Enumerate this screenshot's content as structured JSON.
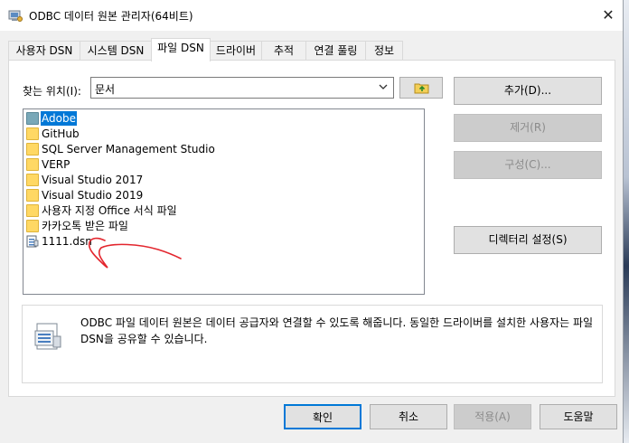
{
  "window": {
    "title": "ODBC 데이터 원본 관리자(64비트)",
    "close_glyph": "✕"
  },
  "tabs": [
    {
      "label": "사용자 DSN"
    },
    {
      "label": "시스템 DSN"
    },
    {
      "label": "파일 DSN",
      "active": true
    },
    {
      "label": "드라이버"
    },
    {
      "label": "추적"
    },
    {
      "label": "연결 풀링"
    },
    {
      "label": "정보"
    }
  ],
  "look_in": {
    "label": "찾는 위치(I):",
    "value": "문서"
  },
  "file_list": [
    {
      "name": "Adobe",
      "type": "folder",
      "selected": true
    },
    {
      "name": "GitHub",
      "type": "folder"
    },
    {
      "name": "SQL Server Management Studio",
      "type": "folder"
    },
    {
      "name": "VERP",
      "type": "folder"
    },
    {
      "name": "Visual Studio 2017",
      "type": "folder"
    },
    {
      "name": "Visual Studio 2019",
      "type": "folder"
    },
    {
      "name": "사용자 지정 Office 서식 파일",
      "type": "folder"
    },
    {
      "name": "카카오톡 받은 파일",
      "type": "folder"
    },
    {
      "name": "1111.dsn",
      "type": "dsn-file"
    }
  ],
  "side_buttons": {
    "add": "추가(D)...",
    "remove": "제거(R)",
    "configure": "구성(C)...",
    "set_directory": "디렉터리 설정(S)"
  },
  "info": {
    "text": "ODBC 파일 데이터 원본은 데이터 공급자와 연결할 수 있도록 해줍니다. 동일한 드라이버를 설치한 사용자는 파일 DSN을 공유할 수 있습니다."
  },
  "bottom_buttons": {
    "ok": "확인",
    "cancel": "취소",
    "apply": "적용(A)",
    "help": "도움말"
  },
  "colors": {
    "accent": "#0078d7",
    "annotation": "#e3262e",
    "folder": "#ffd864"
  }
}
